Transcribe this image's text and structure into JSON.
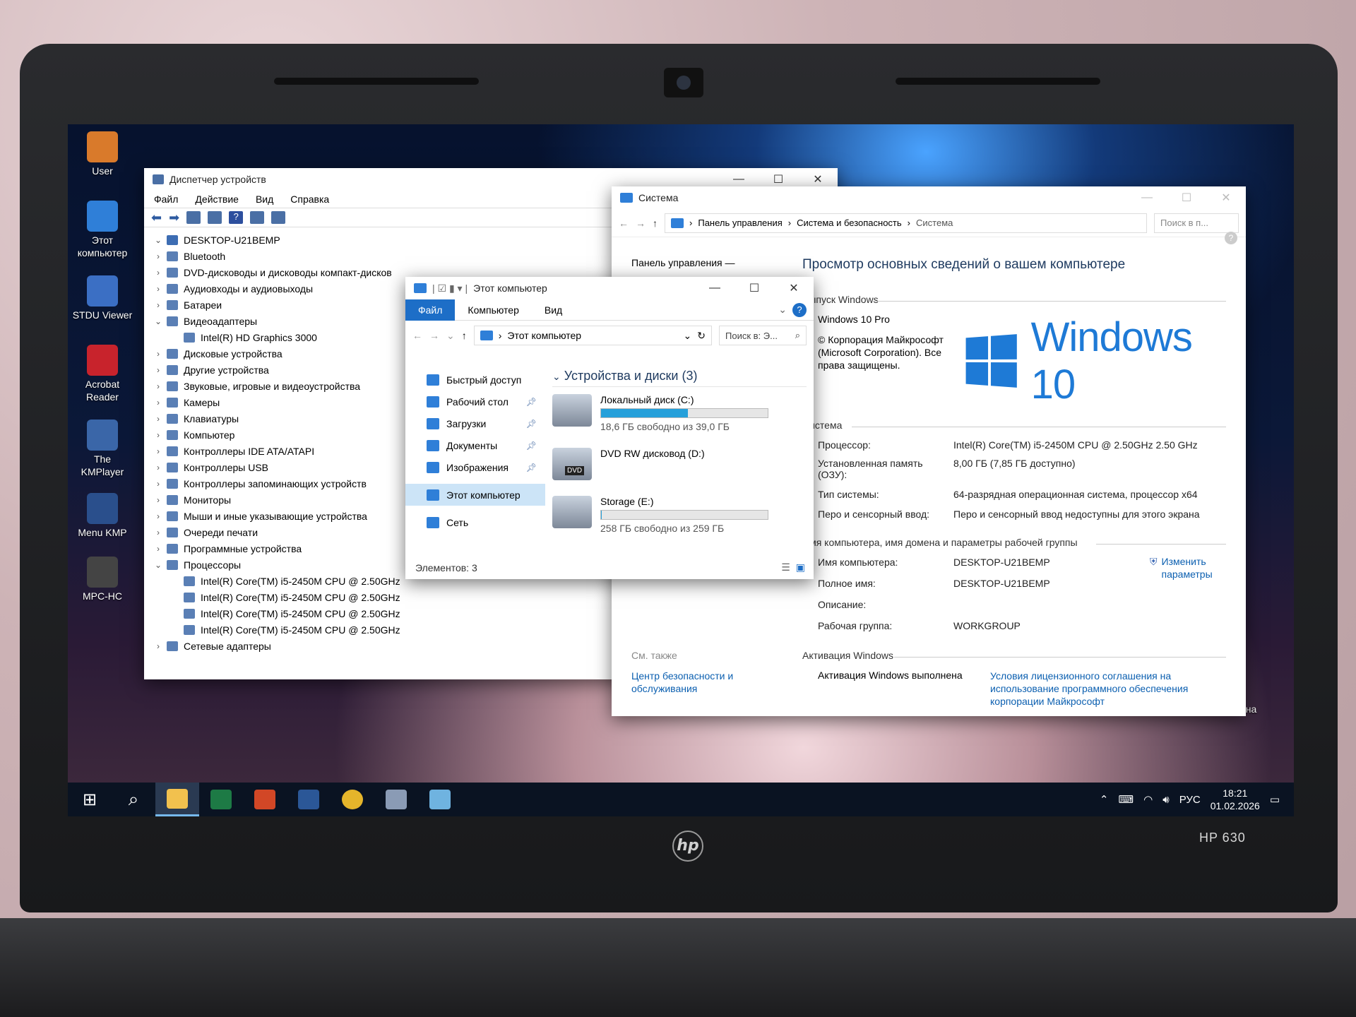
{
  "laptop": {
    "brand": "hp",
    "model": "HP 630"
  },
  "desktop": {
    "icons": [
      {
        "label": "User",
        "color": "#d97a2b"
      },
      {
        "label": "Этот компьютер",
        "color": "#2f7fd8"
      },
      {
        "label": "STDU Viewer",
        "color": "#3b6fc4"
      },
      {
        "label": "Acrobat Reader",
        "color": "#c8232c"
      },
      {
        "label": "The KMPlayer",
        "color": "#3a66a8"
      },
      {
        "label": "Menu KMP",
        "color": "#2a4f8c"
      },
      {
        "label": "MPC-HC",
        "color": "#444444"
      }
    ],
    "recycle_bin": "Корзина"
  },
  "device_manager": {
    "title": "Диспетчер устройств",
    "menu": [
      "Файл",
      "Действие",
      "Вид",
      "Справка"
    ],
    "root": "DESKTOP-U21BEMP",
    "nodes": [
      {
        "label": "Bluetooth",
        "expanded": false
      },
      {
        "label": "DVD-дисководы и дисководы компакт-дисков",
        "expanded": false
      },
      {
        "label": "Аудиовходы и аудиовыходы",
        "expanded": false
      },
      {
        "label": "Батареи",
        "expanded": false
      },
      {
        "label": "Видеоадаптеры",
        "expanded": true
      },
      {
        "label": "Intel(R) HD Graphics 3000",
        "child": true
      },
      {
        "label": "Дисковые устройства",
        "expanded": false
      },
      {
        "label": "Другие устройства",
        "expanded": false
      },
      {
        "label": "Звуковые, игровые и видеоустройства",
        "expanded": false
      },
      {
        "label": "Камеры",
        "expanded": false
      },
      {
        "label": "Клавиатуры",
        "expanded": false
      },
      {
        "label": "Компьютер",
        "expanded": false
      },
      {
        "label": "Контроллеры IDE ATA/ATAPI",
        "expanded": false
      },
      {
        "label": "Контроллеры USB",
        "expanded": false
      },
      {
        "label": "Контроллеры запоминающих устройств",
        "expanded": false
      },
      {
        "label": "Мониторы",
        "expanded": false
      },
      {
        "label": "Мыши и иные указывающие устройства",
        "expanded": false
      },
      {
        "label": "Очереди печати",
        "expanded": false
      },
      {
        "label": "Программные устройства",
        "expanded": false
      },
      {
        "label": "Процессоры",
        "expanded": true
      },
      {
        "label": "Intel(R) Core(TM) i5-2450M CPU @ 2.50GHz",
        "child": true
      },
      {
        "label": "Intel(R) Core(TM) i5-2450M CPU @ 2.50GHz",
        "child": true
      },
      {
        "label": "Intel(R) Core(TM) i5-2450M CPU @ 2.50GHz",
        "child": true
      },
      {
        "label": "Intel(R) Core(TM) i5-2450M CPU @ 2.50GHz",
        "child": true
      },
      {
        "label": "Сетевые адаптеры",
        "expanded": false
      }
    ]
  },
  "system": {
    "title": "Система",
    "breadcrumb": [
      "Панель управления",
      "Система и безопасность",
      "Система"
    ],
    "search_placeholder": "Поиск в п...",
    "left_link": "Панель управления —",
    "heading": "Просмотр основных сведений о вашем компьютере",
    "edition_section": "Выпуск Windows",
    "edition": "Windows 10 Pro",
    "copyright": "© Корпорация Майкрософт (Microsoft Corporation). Все права защищены.",
    "logo_text": "Windows 10",
    "system_section": "Система",
    "processor_label": "Процессор:",
    "processor": "Intel(R) Core(TM) i5-2450M CPU @ 2.50GHz   2.50 GHz",
    "ram_label": "Установленная память (ОЗУ):",
    "ram": "8,00 ГБ (7,85 ГБ доступно)",
    "type_label": "Тип системы:",
    "type": "64-разрядная операционная система, процессор x64",
    "pen_label": "Перо и сенсорный ввод:",
    "pen": "Перо и сенсорный ввод недоступны для этого экрана",
    "name_section": "Имя компьютера, имя домена и параметры рабочей группы",
    "computer_name_label": "Имя компьютера:",
    "computer_name": "DESKTOP-U21BEMP",
    "full_name_label": "Полное имя:",
    "full_name": "DESKTOP-U21BEMP",
    "desc_label": "Описание:",
    "workgroup_label": "Рабочая группа:",
    "workgroup": "WORKGROUP",
    "change_link": "Изменить параметры",
    "see_also": "См. также",
    "security_link": "Центр безопасности и обслуживания",
    "activation_section": "Активация Windows",
    "activation_status": "Активация Windows выполнена",
    "license_link": "Условия лицензионного соглашения на использование программного обеспечения корпорации Майкрософт"
  },
  "explorer": {
    "title": "Этот компьютер",
    "tabs": [
      "Файл",
      "Компьютер",
      "Вид"
    ],
    "address": "Этот компьютер",
    "search_placeholder": "Поиск в: Э...",
    "nav": [
      "Быстрый доступ",
      "Рабочий стол",
      "Загрузки",
      "Документы",
      "Изображения",
      "Этот компьютер",
      "Сеть"
    ],
    "group_header": "Устройства и диски (3)",
    "drives": [
      {
        "name": "Локальный диск (C:)",
        "detail": "18,6 ГБ свободно из 39,0 ГБ",
        "used_fraction": 0.52
      },
      {
        "name": "DVD RW дисковод (D:)",
        "detail": "",
        "badge": "DVD"
      },
      {
        "name": "Storage (E:)",
        "detail": "258 ГБ свободно из 259 ГБ",
        "used_fraction": 0.004
      }
    ],
    "status": "Элементов: 3"
  },
  "taskbar": {
    "apps": [
      {
        "name": "start",
        "color": "#ffffff"
      },
      {
        "name": "search",
        "color": "#ffffff"
      },
      {
        "name": "file-explorer",
        "color": "#f2c14e"
      },
      {
        "name": "excel",
        "color": "#1d7a45"
      },
      {
        "name": "powerpoint",
        "color": "#d24726"
      },
      {
        "name": "word",
        "color": "#2b5797"
      },
      {
        "name": "chrome",
        "color": "#e5b52b"
      },
      {
        "name": "device-manager",
        "color": "#8a9bb5"
      },
      {
        "name": "system",
        "color": "#6fb3e0"
      }
    ],
    "language": "РУС",
    "time": "18:21",
    "date": "01.02.2026"
  }
}
